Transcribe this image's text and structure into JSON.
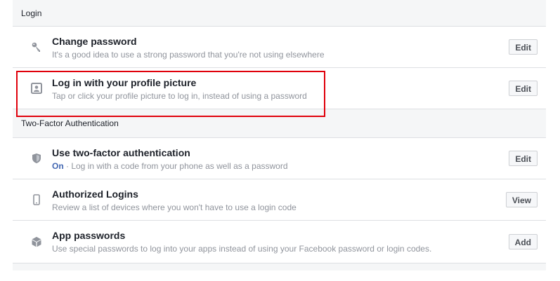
{
  "sections": [
    {
      "title": "Login",
      "rows": [
        {
          "icon": "key-icon",
          "title": "Change password",
          "desc": "It's a good idea to use a strong password that you're not using elsewhere",
          "button": "Edit"
        },
        {
          "icon": "profile-picture-icon",
          "title": "Log in with your profile picture",
          "desc": "Tap or click your profile picture to log in, instead of using a password",
          "button": "Edit"
        }
      ]
    },
    {
      "title": "Two-Factor Authentication",
      "rows": [
        {
          "icon": "shield-icon",
          "title": "Use two-factor authentication",
          "status": "On",
          "desc": " · Log in with a code from your phone as well as a password",
          "button": "Edit"
        },
        {
          "icon": "phone-icon",
          "title": "Authorized Logins",
          "desc": "Review a list of devices where you won't have to use a login code",
          "button": "View"
        },
        {
          "icon": "cube-icon",
          "title": "App passwords",
          "desc": "Use special passwords to log into your apps instead of using your Facebook password or login codes.",
          "button": "Add"
        }
      ]
    }
  ],
  "colors": {
    "highlight": "#e0000b",
    "on_status": "#4267b2"
  }
}
